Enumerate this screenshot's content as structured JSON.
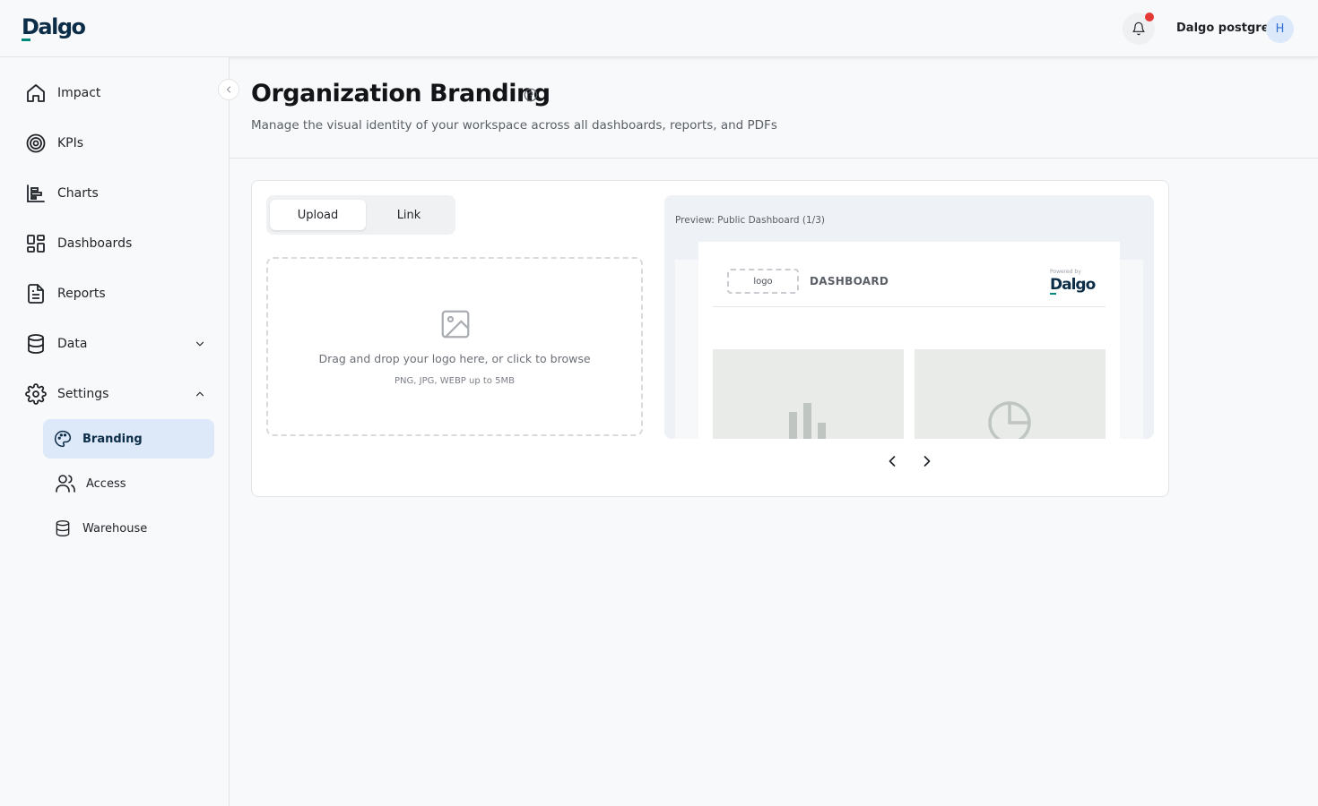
{
  "header": {
    "brand": "Dalgo",
    "username": "Dalgo postgres",
    "avatar_initial": "H",
    "notification_dot_color": "#e53935"
  },
  "sidebar": {
    "items": [
      {
        "label": "Impact",
        "icon": "home-icon"
      },
      {
        "label": "KPIs",
        "icon": "target-icon"
      },
      {
        "label": "Charts",
        "icon": "bar-chart-icon"
      },
      {
        "label": "Dashboards",
        "icon": "grid-icon"
      },
      {
        "label": "Reports",
        "icon": "document-icon"
      },
      {
        "label": "Data",
        "icon": "database-icon",
        "expandable": true,
        "expanded": false
      },
      {
        "label": "Settings",
        "icon": "gear-icon",
        "expandable": true,
        "expanded": true
      }
    ],
    "settings_children": [
      {
        "label": "Branding",
        "icon": "palette-icon",
        "active": true
      },
      {
        "label": "Access",
        "icon": "users-icon",
        "active": false
      },
      {
        "label": "Warehouse",
        "icon": "database-icon",
        "active": false
      }
    ]
  },
  "page": {
    "title": "Organization Branding",
    "subtitle": "Manage the visual identity of your workspace across all dashboards, reports, and PDFs"
  },
  "upload": {
    "tabs": [
      "Upload",
      "Link"
    ],
    "active_tab": "Upload",
    "dropzone_text": "Drag and drop your logo here, or click to browse",
    "dropzone_hint": "PNG, JPG, WEBP up to 5MB"
  },
  "preview": {
    "label": "Preview: Public Dashboard (1/3)",
    "logo_placeholder": "logo",
    "dashboard_title": "DASHBOARD",
    "powered_by": "Powered by",
    "powered_brand": "Dalgo"
  },
  "colors": {
    "brand_navy": "#0c2d48",
    "brand_teal": "#00897b",
    "active_nav_bg": "#dde8f8"
  }
}
